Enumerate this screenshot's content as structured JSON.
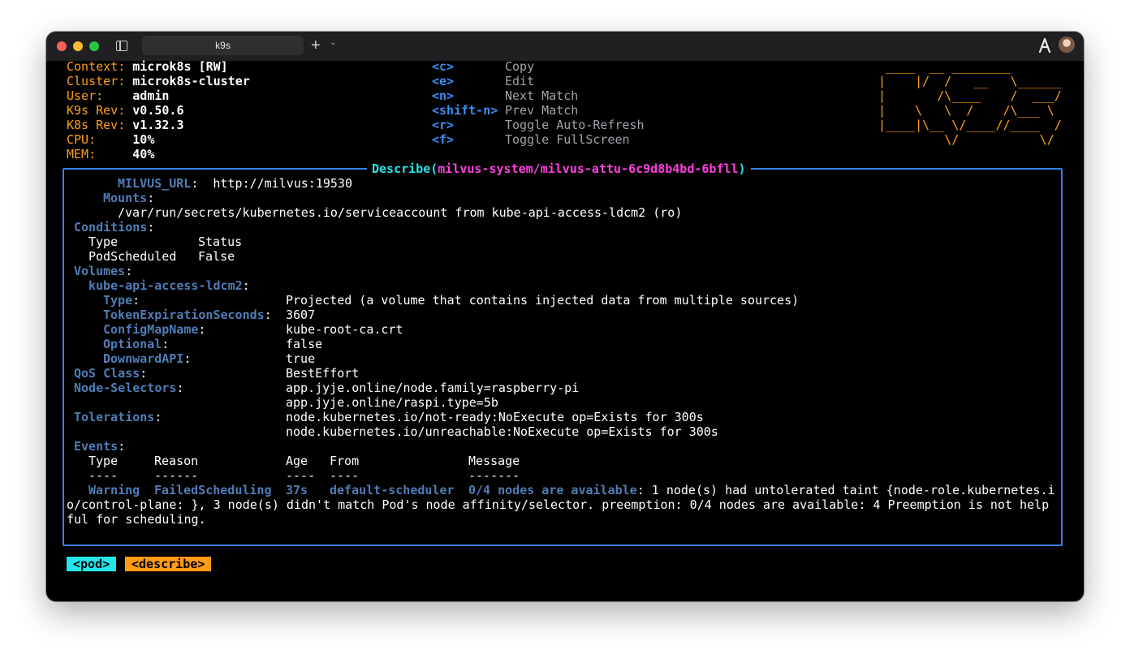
{
  "window": {
    "tab_title": "k9s"
  },
  "header": {
    "info": [
      {
        "label": "Context:",
        "value": "microk8s [RW]"
      },
      {
        "label": "Cluster:",
        "value": "microk8s-cluster"
      },
      {
        "label": "User:",
        "value": "admin"
      },
      {
        "label": "K9s Rev:",
        "value": "v0.50.6"
      },
      {
        "label": "K8s Rev:",
        "value": "v1.32.3"
      },
      {
        "label": "CPU:",
        "value": "10%"
      },
      {
        "label": "MEM:",
        "value": "40%"
      }
    ],
    "shortcuts": [
      {
        "key": "<c>",
        "action": "Copy"
      },
      {
        "key": "<e>",
        "action": "Edit"
      },
      {
        "key": "<n>",
        "action": "Next Match"
      },
      {
        "key": "<shift-n>",
        "action": "Prev Match"
      },
      {
        "key": "<r>",
        "action": "Toggle Auto-Refresh"
      },
      {
        "key": "<f>",
        "action": "Toggle FullScreen"
      }
    ],
    "logo_lines": [
      " ____  __ ________       ",
      "|    |/  /   __   \\______",
      "|       /\\____    /  ___/",
      "|    \\   \\  /    /\\___ \\ ",
      "|____|\\__ \\/____//____  /",
      "         \\/           \\/ "
    ]
  },
  "describe": {
    "title_prefix": "Describe(",
    "title_resource": "milvus-system/milvus-attu-6c9d8b4bd-6bfll",
    "title_suffix": ")",
    "env_key": "MILVUS_URL",
    "env_value": "http://milvus:19530",
    "mounts_key": "Mounts",
    "mount_path": "/var/run/secrets/kubernetes.io/serviceaccount from kube-api-access-ldcm2 (ro)",
    "conditions_key": "Conditions",
    "cond_header_type": "Type",
    "cond_header_status": "Status",
    "cond_row_type": "PodScheduled",
    "cond_row_status": "False",
    "volumes_key": "Volumes",
    "volume_name": "kube-api-access-ldcm2",
    "volume_fields": [
      {
        "key": "Type",
        "value": "Projected (a volume that contains injected data from multiple sources)"
      },
      {
        "key": "TokenExpirationSeconds",
        "value": "3607"
      },
      {
        "key": "ConfigMapName",
        "value": "kube-root-ca.crt"
      },
      {
        "key": "Optional",
        "value": "false"
      },
      {
        "key": "DownwardAPI",
        "value": "true"
      }
    ],
    "qos_key": "QoS Class",
    "qos_value": "BestEffort",
    "selectors_key": "Node-Selectors",
    "selectors": [
      "app.jyje.online/node.family=raspberry-pi",
      "app.jyje.online/raspi.type=5b"
    ],
    "tolerations_key": "Tolerations",
    "tolerations": [
      "node.kubernetes.io/not-ready:NoExecute op=Exists for 300s",
      "node.kubernetes.io/unreachable:NoExecute op=Exists for 300s"
    ],
    "events_key": "Events",
    "event_headers": [
      "Type",
      "Reason",
      "Age",
      "From",
      "Message"
    ],
    "event_rules": [
      "----",
      "------",
      "----",
      "----",
      "-------"
    ],
    "event": {
      "type": "Warning",
      "reason": "FailedScheduling",
      "age": "37s",
      "from": "default-scheduler",
      "message_highlight": "0/4 nodes are available",
      "message_line1": ": 1 node(s) had untolerated taint {node-role.kubernetes.i",
      "message_line2": "o/control-plane: }, 3 node(s) didn't match Pod's node affinity/selector. preemption: 0/4 nodes are available: 4 Preemption is not help",
      "message_line3": "ful for scheduling."
    }
  },
  "crumbs": [
    "<pod>",
    "<describe>"
  ]
}
